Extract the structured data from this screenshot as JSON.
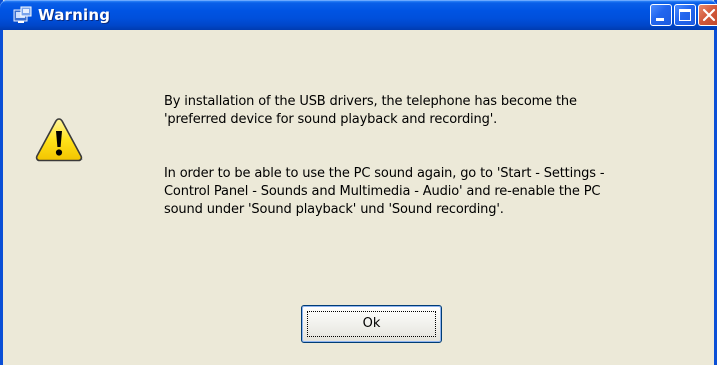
{
  "window": {
    "title": "Warning",
    "colors": {
      "titlebar": "#0054e3",
      "client": "#ece9d8",
      "close": "#d2583a"
    }
  },
  "titlebar_buttons": [
    "minimize-icon",
    "maximize-icon",
    "close-icon"
  ],
  "message": {
    "icon": "warning-icon",
    "paragraph1": "By installation of the USB drivers, the telephone has become the 'preferred device for sound playback and recording'.",
    "paragraph2": "In order to be able to use the PC sound again, go to 'Start - Settings - Control Panel - Sounds and Multimedia - Audio' and re-enable the PC sound under 'Sound playback' und 'Sound recording'."
  },
  "buttons": {
    "ok_label": "Ok"
  }
}
